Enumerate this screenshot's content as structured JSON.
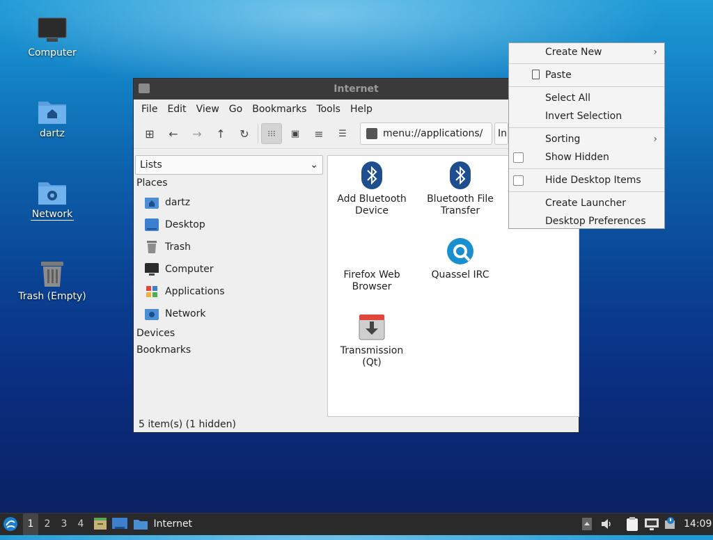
{
  "desktop": {
    "icons": [
      {
        "label": "Computer"
      },
      {
        "label": "dartz"
      },
      {
        "label": "Network"
      },
      {
        "label": "Trash (Empty)"
      }
    ]
  },
  "window": {
    "title": "Internet",
    "menu": [
      "File",
      "Edit",
      "View",
      "Go",
      "Bookmarks",
      "Tools",
      "Help"
    ],
    "address": "menu://applications/",
    "address_overflow": "In",
    "side_select": "Lists",
    "sections": {
      "places": "Places",
      "devices": "Devices",
      "bookmarks": "Bookmarks"
    },
    "places": [
      {
        "label": "dartz",
        "icon": "home-folder-icon"
      },
      {
        "label": "Desktop",
        "icon": "desktop-icon"
      },
      {
        "label": "Trash",
        "icon": "trash-icon"
      },
      {
        "label": "Computer",
        "icon": "computer-icon"
      },
      {
        "label": "Applications",
        "icon": "applications-icon"
      },
      {
        "label": "Network",
        "icon": "network-folder-icon"
      }
    ],
    "apps": [
      {
        "line1": "Add Bluetooth",
        "line2": "Device",
        "icon": "bluetooth-icon"
      },
      {
        "line1": "Bluetooth File",
        "line2": "Transfer",
        "icon": "bluetooth-icon"
      },
      {
        "line1": "Firefox Web",
        "line2": "Browser",
        "icon": "firefox-icon"
      },
      {
        "line1": "Quassel IRC",
        "line2": "",
        "icon": "quassel-icon"
      },
      {
        "line1": "Transmission",
        "line2": "(Qt)",
        "icon": "transmission-icon"
      }
    ],
    "status": "5 item(s) (1 hidden)"
  },
  "context_menu": {
    "create_new": "Create New",
    "paste": "Paste",
    "select_all": "Select All",
    "invert_selection": "Invert Selection",
    "sorting": "Sorting",
    "show_hidden": "Show Hidden",
    "hide_desktop_items": "Hide Desktop Items",
    "create_launcher": "Create Launcher",
    "desktop_preferences": "Desktop Preferences"
  },
  "taskbar": {
    "workspaces": [
      "1",
      "2",
      "3",
      "4"
    ],
    "active_workspace": "1",
    "task_label": "Internet",
    "clock": "14:09"
  }
}
